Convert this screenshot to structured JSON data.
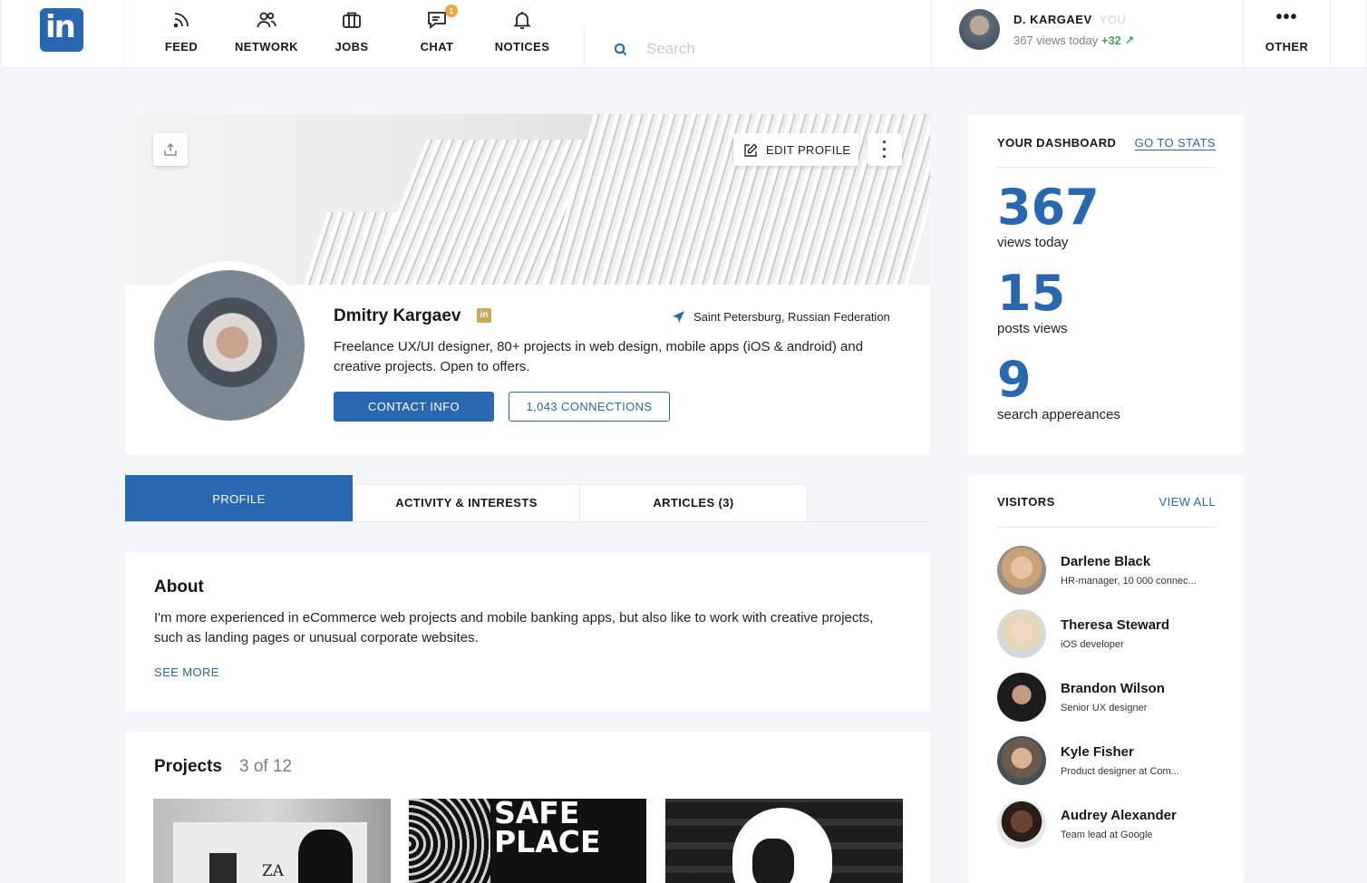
{
  "app": {
    "logo_text": "in",
    "brand_color": "#2867b2"
  },
  "nav": [
    {
      "label": "FEED",
      "icon": "rss-icon"
    },
    {
      "label": "NETWORK",
      "icon": "users-icon"
    },
    {
      "label": "JOBS",
      "icon": "briefcase-icon"
    },
    {
      "label": "CHAT",
      "icon": "chat-icon",
      "badge": "1"
    },
    {
      "label": "NOTICES",
      "icon": "bell-icon"
    }
  ],
  "search": {
    "placeholder": "Search",
    "value": ""
  },
  "user": {
    "name": "D. KARGAEV",
    "you_label": "YOU",
    "views_text": "367 views today",
    "views_delta": "+32 ↗"
  },
  "other": {
    "dots": "•••",
    "label": "OTHER"
  },
  "profile": {
    "edit_label": "EDIT PROFILE",
    "name": "Dmitry Kargaev",
    "badge": "in",
    "location": "Saint Petersburg, Russian Federation",
    "bio": "Freelance UX/UI designer, 80+ projects in web design, mobile apps  (iOS & android) and creative projects. Open to offers.",
    "contact_label": "CONTACT INFO",
    "connections_label": "1,043 CONNECTIONS"
  },
  "tabs": [
    {
      "label": "PROFILE",
      "active": true
    },
    {
      "label": "ACTIVITY & INTERESTS",
      "active": false
    },
    {
      "label": "ARTICLES (3)",
      "active": false
    }
  ],
  "about": {
    "title": "About",
    "text": "I'm more experienced in eCommerce web projects and mobile banking apps, but also like to work with creative projects, such as landing pages or unusual corporate websites.",
    "see_more": "SEE MORE"
  },
  "projects": {
    "title": "Projects",
    "count": "3 of 12",
    "items": [
      {
        "caption": "ZA"
      },
      {
        "caption": "SAFE PLACE"
      },
      {
        "caption": ""
      }
    ]
  },
  "dashboard": {
    "title": "YOUR DASHBOARD",
    "link": "GO TO STATS",
    "stats": [
      {
        "value": "367",
        "label": "views today"
      },
      {
        "value": "15",
        "label": "posts views"
      },
      {
        "value": "9",
        "label": "search appereances"
      }
    ]
  },
  "visitors": {
    "title": "VISITORS",
    "link": "VIEW ALL",
    "items": [
      {
        "name": "Darlene Black",
        "role": "HR-manager, 10 000 connec...",
        "color": "#d9b48f"
      },
      {
        "name": "Theresa Steward",
        "role": "iOS developer",
        "color": "#e8d9c8"
      },
      {
        "name": "Brandon Wilson",
        "role": "Senior UX designer",
        "color": "#2b2b2b"
      },
      {
        "name": "Kyle Fisher",
        "role": "Product designer at Com...",
        "color": "#7a6a5a"
      },
      {
        "name": "Audrey Alexander",
        "role": "Team lead at Google",
        "color": "#3a2a22"
      }
    ]
  }
}
